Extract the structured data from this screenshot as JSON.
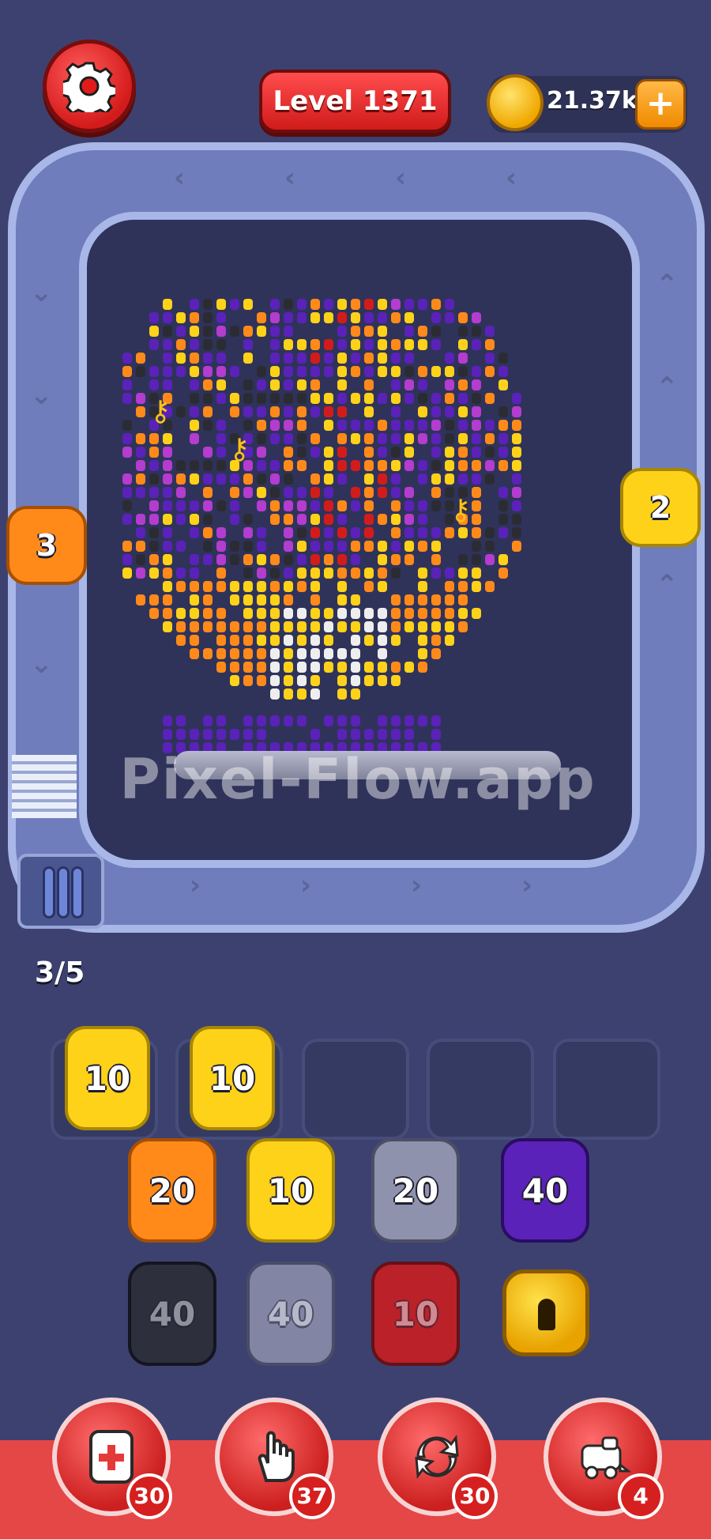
{
  "header": {
    "level_label": "Level 1371",
    "coins": "21.37k",
    "add_coins_label": "+"
  },
  "colors": {
    "background": "#3d4170",
    "track": "#6f7dbd",
    "board": "#2f335a",
    "accent_red": "#e54646",
    "pig_yellow": "#ffd21a",
    "pig_orange": "#ff8a1a",
    "pig_gray": "#8f92ad",
    "pig_purple": "#5a22b8",
    "pig_black": "#2b2c33",
    "pig_red": "#d21c1c"
  },
  "side_pigs": [
    {
      "value": "3",
      "color": "#ff8a1a"
    },
    {
      "value": "2",
      "color": "#ffd21a"
    }
  ],
  "stack_counter": "3/5",
  "watermark": "Pixel-Flow.app",
  "slots": [
    {
      "value": "10",
      "color": "#ffd21a"
    },
    {
      "value": "10",
      "color": "#ffd21a"
    },
    {
      "value": "",
      "color": ""
    },
    {
      "value": "",
      "color": ""
    },
    {
      "value": "",
      "color": ""
    }
  ],
  "queue_rows": [
    [
      {
        "value": "20",
        "color": "#ff8a1a"
      },
      {
        "value": "10",
        "color": "#ffd21a"
      },
      {
        "value": "20",
        "color": "#8f92ad"
      },
      {
        "value": "40",
        "color": "#5a22b8"
      }
    ],
    [
      {
        "value": "40",
        "color": "#2b2c33"
      },
      {
        "value": "40",
        "color": "#8f92ad"
      },
      {
        "value": "10",
        "color": "#d21c1c"
      },
      {
        "value": "",
        "color": "locked"
      }
    ]
  ],
  "tools": [
    {
      "name": "add-slot",
      "count": "30"
    },
    {
      "name": "hand-pick",
      "count": "37"
    },
    {
      "name": "shuffle",
      "count": "30"
    },
    {
      "name": "train",
      "count": "4"
    }
  ]
}
